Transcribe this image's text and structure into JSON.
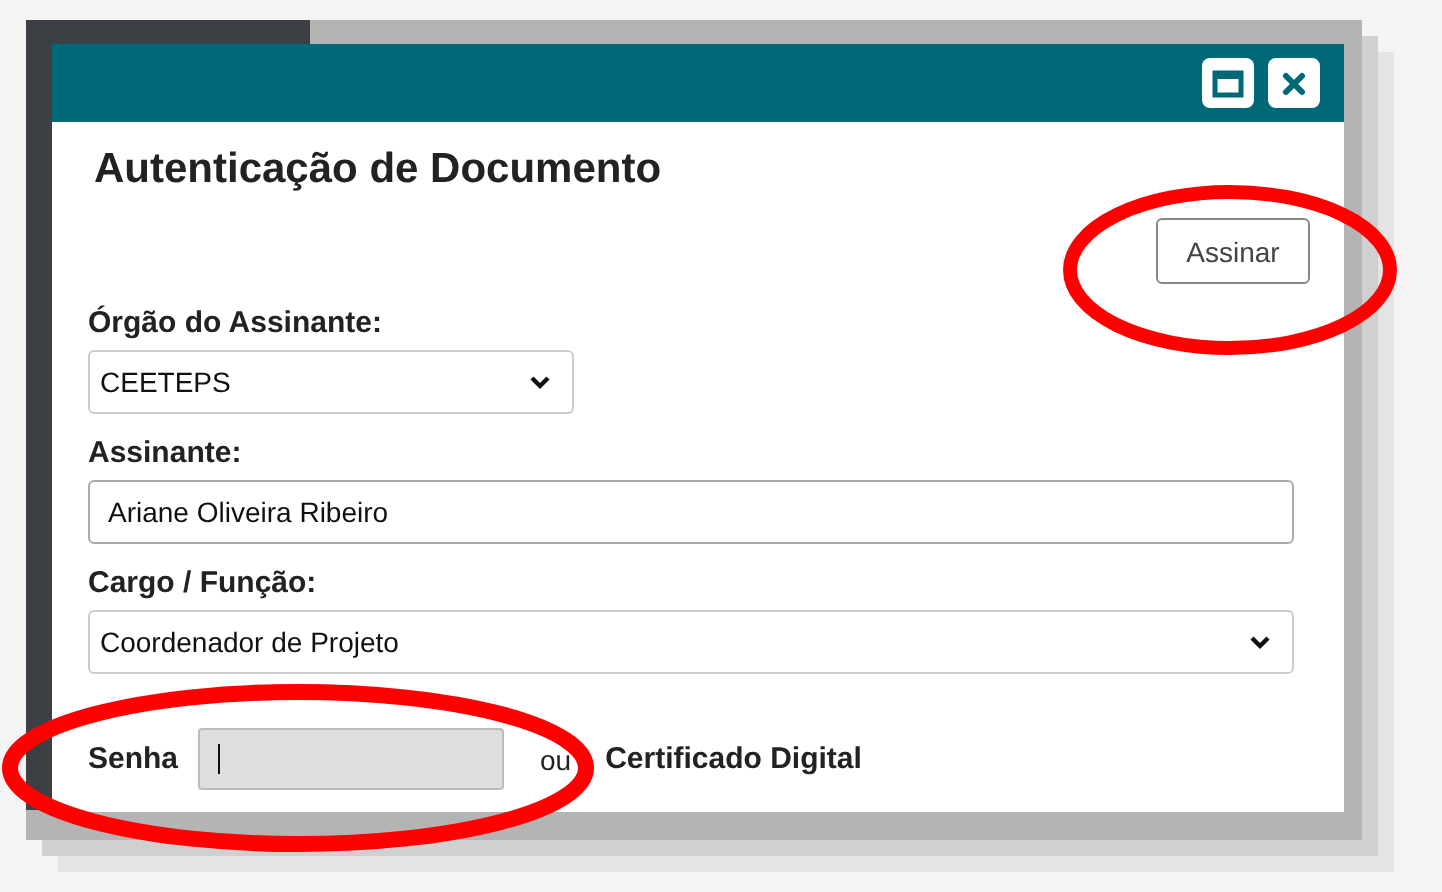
{
  "dialog": {
    "title": "Autenticação de Documento",
    "sign_button": "Assinar",
    "fields": [
      {
        "kind": "select",
        "label": "Órgão do Assinante:",
        "value": "CEETEPS"
      },
      {
        "kind": "text",
        "label": "Assinante:",
        "value": "Ariane Oliveira Ribeiro"
      },
      {
        "kind": "select",
        "label": "Cargo / Função:",
        "value": "Coordenador de Projeto"
      }
    ],
    "password": {
      "label": "Senha",
      "focused": true,
      "separator": "ou",
      "alternative": "Certificado Digital"
    }
  }
}
